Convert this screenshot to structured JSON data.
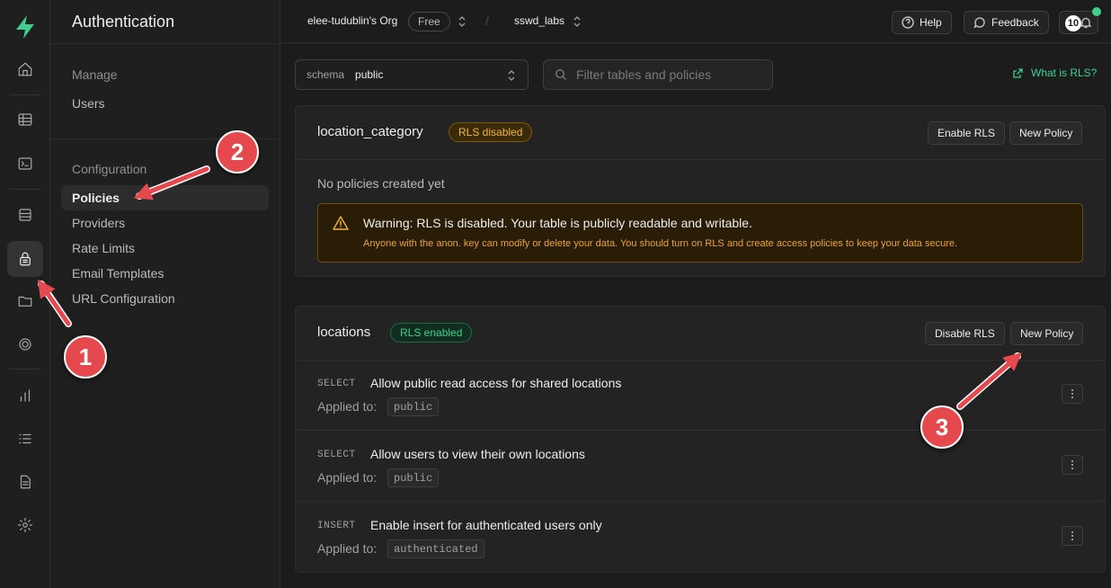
{
  "rail": {
    "icons": [
      "supabase-logo-icon",
      "home-icon",
      "table-editor-icon",
      "sql-editor-icon",
      "database-icon",
      "auth-lock-icon",
      "storage-icon",
      "realtime-icon",
      "reports-icon",
      "logs-icon",
      "docs-icon",
      "settings-icon"
    ]
  },
  "sidebar": {
    "title": "Authentication",
    "manage_label": "Manage",
    "manage_items": [
      {
        "label": "Users"
      }
    ],
    "config_label": "Configuration",
    "config_items": [
      {
        "label": "Policies",
        "selected": true
      },
      {
        "label": "Providers"
      },
      {
        "label": "Rate Limits"
      },
      {
        "label": "Email Templates"
      },
      {
        "label": "URL Configuration"
      }
    ]
  },
  "topbar": {
    "org": "elee-tudublin's Org",
    "plan": "Free",
    "project": "sswd_labs",
    "help": "Help",
    "feedback": "Feedback",
    "notif_count": "10"
  },
  "toolbar": {
    "schema_key": "schema",
    "schema_value": "public",
    "filter_placeholder": "Filter tables and policies",
    "rls_link": "What is RLS?"
  },
  "tables": [
    {
      "name": "location_category",
      "status": "RLS disabled",
      "toggle_btn": "Enable RLS",
      "new_btn": "New Policy",
      "empty": "No policies created yet",
      "warning_title": "Warning: RLS is disabled. Your table is publicly readable and writable.",
      "warning_body": "Anyone with the anon. key can modify or delete your data. You should turn on RLS and create access policies to keep your data secure."
    },
    {
      "name": "locations",
      "status": "RLS enabled",
      "toggle_btn": "Disable RLS",
      "new_btn": "New Policy",
      "policies": [
        {
          "command": "SELECT",
          "name": "Allow public read access for shared locations",
          "applied_label": "Applied to:",
          "role": "public"
        },
        {
          "command": "SELECT",
          "name": "Allow users to view their own locations",
          "applied_label": "Applied to:",
          "role": "public"
        },
        {
          "command": "INSERT",
          "name": "Enable insert for authenticated users only",
          "applied_label": "Applied to:",
          "role": "authenticated"
        }
      ]
    }
  ],
  "annotations": [
    "1",
    "2",
    "3"
  ],
  "colors": {
    "accent": "#3ecf8e",
    "warning": "#f1b63d",
    "annotation": "#e5484d",
    "background": "#1c1c1c"
  }
}
